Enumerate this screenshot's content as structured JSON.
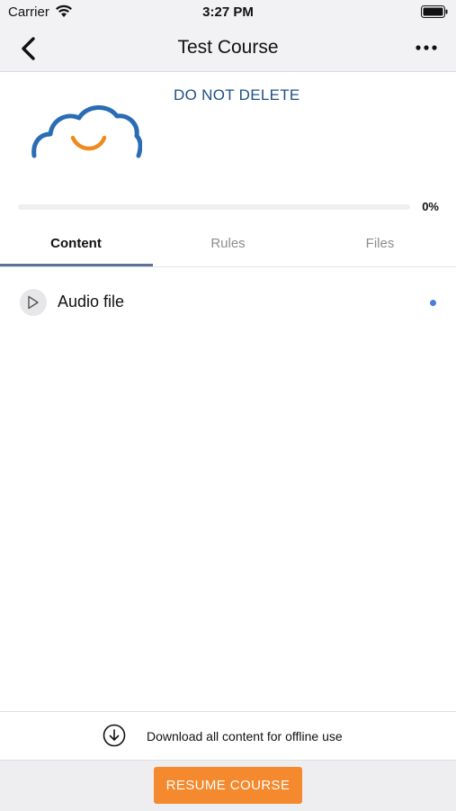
{
  "status_bar": {
    "carrier": "Carrier",
    "time": "3:27 PM",
    "icons": [
      "wifi-icon",
      "battery-icon"
    ]
  },
  "nav_bar": {
    "title": "Test Course",
    "icons": [
      "chevron-left-icon",
      "more-horizontal-icon"
    ]
  },
  "course": {
    "subtitle": "DO NOT DELETE",
    "logo": "cloud-smile-logo",
    "progress_percent": 0,
    "progress_label": "0%"
  },
  "tabs": [
    {
      "label": "Content",
      "active": true
    },
    {
      "label": "Rules",
      "active": false
    },
    {
      "label": "Files",
      "active": false
    }
  ],
  "content_items": [
    {
      "label": "Audio file",
      "icon": "play-icon",
      "unread": true
    }
  ],
  "download": {
    "label": "Download all content for offline use",
    "icon": "download-circle-icon"
  },
  "footer": {
    "resume_label": "RESUME COURSE"
  },
  "colors": {
    "accent_orange": "#f5892d",
    "subtitle_blue": "#1f4f86",
    "tab_indicator": "#5a7396",
    "unread_dot": "#4a7fd8",
    "logo_blue": "#2a6db5",
    "logo_orange": "#ef8a1f"
  }
}
